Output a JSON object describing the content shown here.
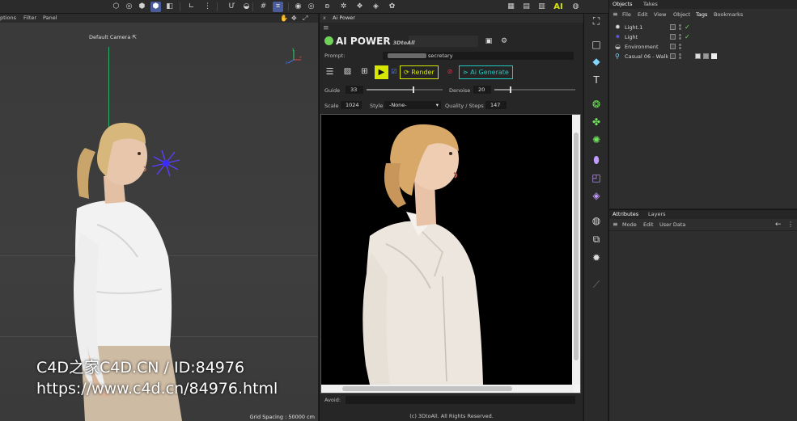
{
  "toolbar": {
    "icons": [
      "cube-icon",
      "cube-icon",
      "cube-icon",
      "cube-icon",
      "axis-icon",
      "magnet-icon",
      "grid-icon",
      "snap-icon",
      "target-icon",
      "hand-icon",
      "rotate-icon",
      "pan-icon",
      "gear-icon",
      "film-icon",
      "render-icon",
      "render-icon",
      "render-icon",
      "ai-icon",
      "gear-icon"
    ],
    "ai_label": "AI"
  },
  "viewport": {
    "menu": {
      "options": "ptions",
      "filter": "Filter",
      "panel": "Panel"
    },
    "camera_label": "Default Camera",
    "grid_spacing": "Grid Spacing : 50000 cm",
    "gizmo": {
      "x": "x",
      "y": "y",
      "z": "z"
    }
  },
  "watermark": {
    "line1": "C4D之家C4D.CN / ID:84976",
    "line2": "https://www.c4d.cn/84976.html"
  },
  "ai_panel": {
    "tab_title": "Ai Power",
    "tab_close": "x",
    "brand_title": "AI POWER",
    "brand_sub": "3DtoAll",
    "prompt_label": "Prompt:",
    "prompt_value": "secretary",
    "render_label": "Render",
    "generate_label": "Ai Generate",
    "guide_label": "Guide",
    "guide_value": "33",
    "guide_level": 0.62,
    "denoise_label": "Denoise",
    "denoise_value": "20",
    "denoise_level": 0.2,
    "scale_label": "Scale",
    "scale_value": "1024",
    "style_label": "Style",
    "style_value": "-None-",
    "quality_label": "Quality / Steps",
    "quality_value": "147",
    "avoid_label": "Avoid:",
    "copyright": "(c) 3DtoAll. All Rights Reserved."
  },
  "object_manager": {
    "tabs": {
      "objects": "Objects",
      "takes": "Takes"
    },
    "menu": {
      "file": "File",
      "edit": "Edit",
      "view": "View",
      "object": "Object",
      "tags": "Tags",
      "bookmarks": "Bookmarks"
    },
    "rows": [
      {
        "name": "Light.1",
        "icon": "light-icon"
      },
      {
        "name": "Light",
        "icon": "light-icon"
      },
      {
        "name": "Environment",
        "icon": "environment-icon"
      },
      {
        "name": "Casual 06 - Walk",
        "icon": "figure-icon"
      }
    ]
  },
  "attributes": {
    "tabs": {
      "attributes": "Attributes",
      "layers": "Layers"
    },
    "menu": {
      "mode": "Mode",
      "edit": "Edit",
      "user_data": "User Data"
    }
  },
  "colors": {
    "accent_yellow": "#d7e600",
    "accent_cyan": "#1fc8c0",
    "accent_purple": "#c29bff",
    "accent_green": "#6fe35a",
    "toolbar_active": "#4a5d9a"
  }
}
